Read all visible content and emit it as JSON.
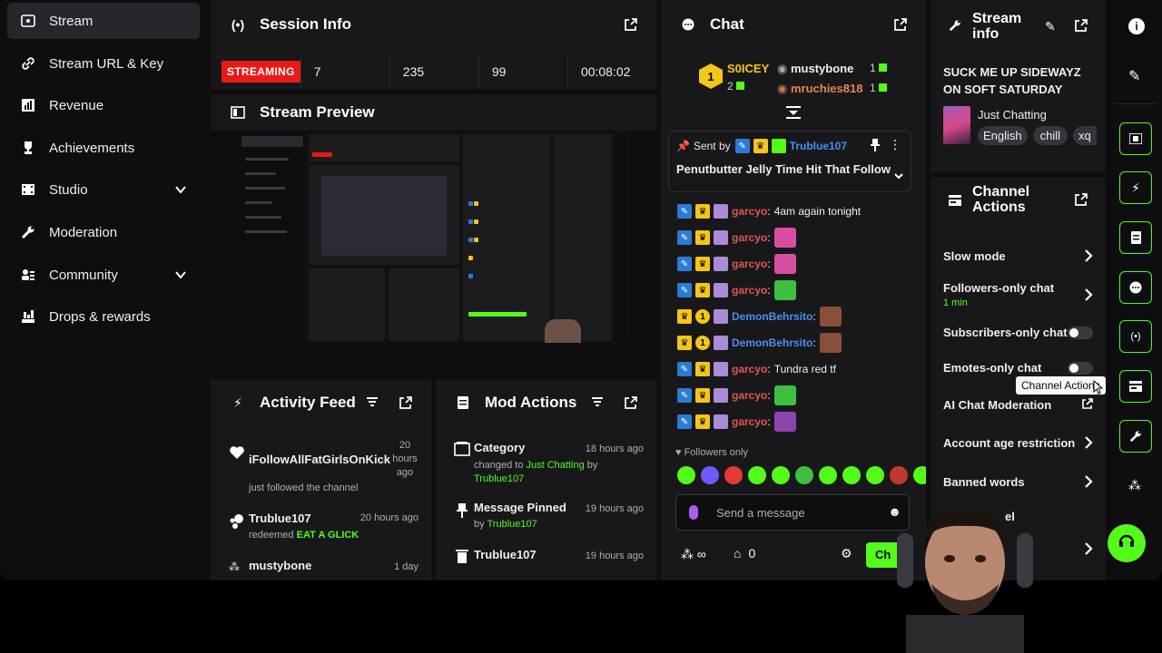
{
  "sidebar": {
    "items": [
      {
        "label": "Stream",
        "icon": "broadcast-icon",
        "active": true
      },
      {
        "label": "Stream URL & Key",
        "icon": "link-icon"
      },
      {
        "label": "Revenue",
        "icon": "chart-icon"
      },
      {
        "label": "Achievements",
        "icon": "trophy-icon"
      },
      {
        "label": "Studio",
        "icon": "film-icon",
        "expandable": true
      },
      {
        "label": "Moderation",
        "icon": "wrench-icon"
      },
      {
        "label": "Community",
        "icon": "people-icon",
        "expandable": true
      },
      {
        "label": "Drops & rewards",
        "icon": "gift-icon"
      }
    ]
  },
  "session_info": {
    "title": "Session Info",
    "status": "STREAMING",
    "stats": [
      "7",
      "235",
      "99",
      "00:08:02"
    ]
  },
  "stream_preview": {
    "title": "Stream Preview"
  },
  "activity_feed": {
    "title": "Activity Feed",
    "items": [
      {
        "name": "iFollowAllFatGirlsOnKick",
        "action": "just followed the channel",
        "time": "20 hours ago"
      },
      {
        "name": "Trublue107",
        "action": "redeemed",
        "highlight": "EAT A GLICK",
        "time": "20 hours ago"
      },
      {
        "name": "mustybone",
        "action": "",
        "time": "1 day"
      }
    ]
  },
  "mod_actions": {
    "title": "Mod Actions",
    "items": [
      {
        "title": "Category",
        "prefix": "changed to",
        "value": "Just Chatting",
        "by_word": "by",
        "by": "Trublue107",
        "time": "18 hours ago"
      },
      {
        "title": "Message Pinned",
        "prefix": "",
        "value": "",
        "by_word": "by",
        "by": "Trublue107",
        "time": "19 hours ago"
      },
      {
        "title": "Trublue107",
        "prefix": "",
        "value": "",
        "by_word": "",
        "by": "",
        "time": "19 hours ago"
      }
    ]
  },
  "chat": {
    "title": "Chat",
    "leaderboard": {
      "first_name": "S0ICEY",
      "first_count": "2",
      "first_rank": "1",
      "second_name": "mustybone",
      "second_count": "1",
      "third_name": "mruchies818",
      "third_count": "1"
    },
    "pinned": {
      "sent_by_label": "Sent by",
      "author": "Trublue107",
      "text": "Penutbutter Jelly Time Hit That Follow"
    },
    "messages": [
      {
        "user": "garcyo",
        "color": "red",
        "text": "4am again tonight",
        "emote": ""
      },
      {
        "user": "garcyo",
        "color": "red",
        "text": "",
        "emote": "#d94fa0"
      },
      {
        "user": "garcyo",
        "color": "red",
        "text": "",
        "emote": "#d94fa0"
      },
      {
        "user": "garcyo",
        "color": "red",
        "text": "",
        "emote": "#3fbf3f"
      },
      {
        "user": "DemonBehrsito",
        "color": "blue",
        "text": "",
        "emote": "#8a4f3a"
      },
      {
        "user": "DemonBehrsito",
        "color": "blue",
        "text": "",
        "emote": "#8a4f3a"
      },
      {
        "user": "garcyo",
        "color": "red",
        "text": "Tundra red tf",
        "emote": ""
      },
      {
        "user": "garcyo",
        "color": "red",
        "text": "",
        "emote": "#3fbf3f"
      },
      {
        "user": "garcyo",
        "color": "red",
        "text": "",
        "emote": "#8e44ad"
      }
    ],
    "mode_label": "Followers only",
    "input_placeholder": "Send a message",
    "points": "0",
    "send_label": "Ch"
  },
  "stream_info": {
    "title": "Stream info",
    "stream_title": "SUCK ME UP SIDEWAYZ ON SOFT SATURDAY",
    "category": "Just Chatting",
    "tags": [
      "English",
      "chill",
      "xq"
    ]
  },
  "channel_actions": {
    "title": "Channel Actions",
    "slow_mode": "Slow mode",
    "followers_only": "Followers-only chat",
    "followers_only_sub": "1 min",
    "subscribers_only": "Subscribers-only chat",
    "emotes_only": "Emotes-only chat",
    "ai_moderation": "AI Chat Moderation",
    "age_restriction": "Account age restriction",
    "banned_words": "Banned words",
    "partial": "el"
  },
  "tooltip": "Channel Actions",
  "colors": {
    "accent": "#53fc18",
    "live": "#e91916",
    "panel": "#18181b"
  }
}
